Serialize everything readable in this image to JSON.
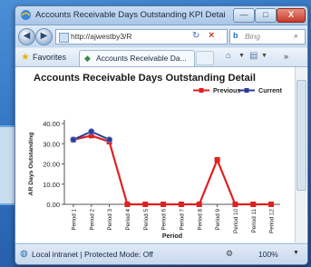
{
  "window": {
    "title": "Accounts Receivable Days Outstanding KPI Detail - Win...",
    "min_label": "—",
    "max_label": "□",
    "close_label": "X"
  },
  "nav": {
    "address": "http://ajwestby3/R",
    "search_placeholder": "Bing",
    "bing_icon": "b",
    "back_icon": "back-arrow-icon",
    "forward_icon": "forward-arrow-icon"
  },
  "favorites": {
    "label": "Favorites",
    "tab_label": "Accounts Receivable Da..."
  },
  "status": {
    "text": "Local intranet | Protected Mode: Off",
    "zoom": "100%"
  },
  "colors": {
    "previous": "#e02020",
    "current": "#2c3d96"
  },
  "chart_data": {
    "type": "line",
    "title": "Accounts Receivable Days Outstanding Detail",
    "xlabel": "Period",
    "ylabel": "AR Days Outstanding",
    "categories": [
      "Period 1",
      "Period 2",
      "Period 3",
      "Period 4",
      "Period 5",
      "Period 6",
      "Period 7",
      "Period 8",
      "Period 9",
      "Period 10",
      "Period 11",
      "Period 12"
    ],
    "ylim": [
      0,
      40
    ],
    "yticks": [
      "0.00",
      "10.00",
      "20.00",
      "30.00",
      "40.00"
    ],
    "grid": false,
    "legend": "top-right",
    "series": [
      {
        "name": "Previous",
        "values": [
          32,
          34,
          31,
          0,
          0,
          0,
          0,
          0,
          22,
          0,
          0,
          0
        ]
      },
      {
        "name": "Current",
        "values": [
          32,
          36,
          32
        ]
      }
    ]
  }
}
